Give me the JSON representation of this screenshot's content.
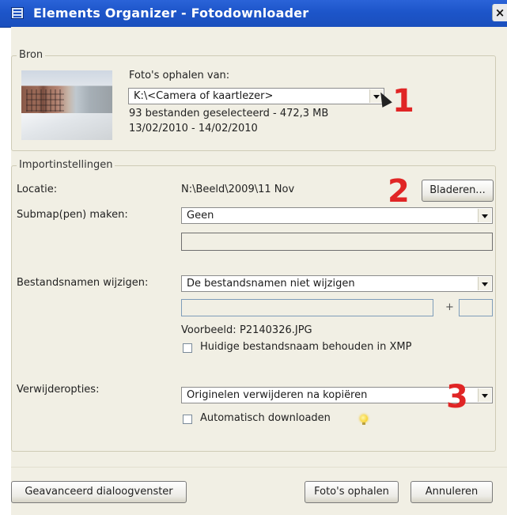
{
  "window": {
    "title": "Elements Organizer - Fotodownloader",
    "close_glyph": "×"
  },
  "source": {
    "legend": "Bron",
    "fetch_label": "Foto's ophalen van:",
    "device_value": "K:\\<Camera of kaartlezer>",
    "selected_info": "93 bestanden geselecteerd - 472,3 MB",
    "date_range": "13/02/2010 - 14/02/2010"
  },
  "import": {
    "legend": "Importinstellingen",
    "location_label": "Locatie:",
    "location_value": "N:\\Beeld\\2009\\11 Nov",
    "browse_label": "Bladeren...",
    "subfolder_label": "Submap(pen) maken:",
    "subfolder_value": "Geen",
    "subfolder_name_value": "",
    "rename_label": "Bestandsnamen wijzigen:",
    "rename_value": "De bestandsnamen niet wijzigen",
    "rename_text_value": "",
    "plus_sign": "+",
    "rename_number_value": "",
    "example_label": "Voorbeeld:",
    "example_value": "P2140326.JPG",
    "keep_name_label": "Huidige bestandsnaam behouden in XMP",
    "keep_name_checked": false,
    "delete_label": "Verwijderopties:",
    "delete_value": "Originelen verwijderen na kopiëren",
    "auto_download_label": "Automatisch downloaden",
    "auto_download_checked": false
  },
  "callouts": [
    "1",
    "2",
    "3"
  ],
  "footer": {
    "advanced_label": "Geavanceerd dialoogvenster",
    "get_photos_label": "Foto's ophalen",
    "cancel_label": "Annuleren"
  },
  "icons": {
    "title": "window-grid-icon",
    "thumbnail": "photo-thumbnail",
    "hint": "lightbulb-icon",
    "pointer": "mouse-cursor-icon"
  },
  "colors": {
    "titlebar": "#1d55c9",
    "dialog_bg": "#f1efe4",
    "callout": "#e02525"
  }
}
